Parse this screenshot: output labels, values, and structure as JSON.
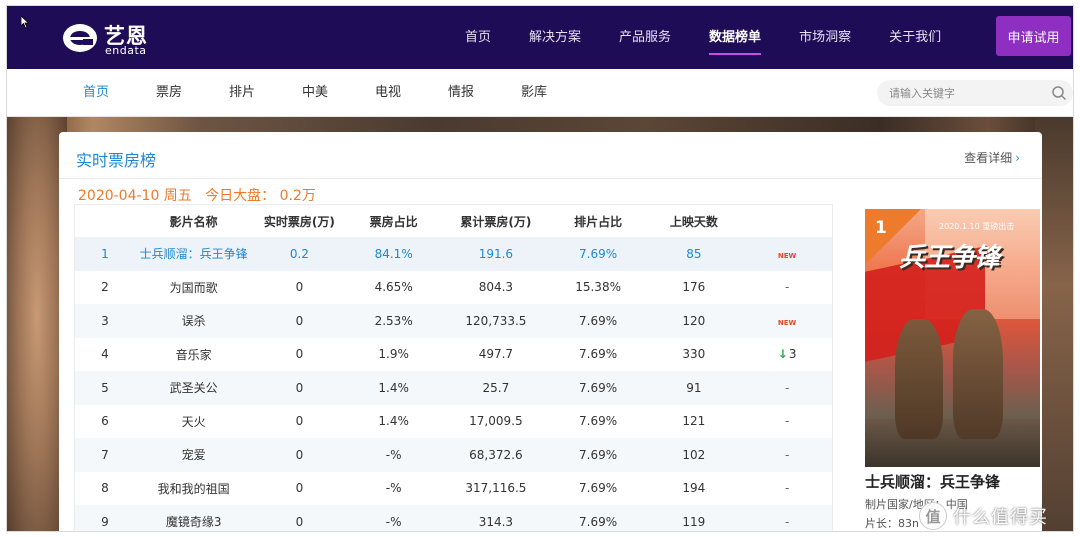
{
  "brand": {
    "name_cn": "艺恩",
    "name_en": "endata"
  },
  "top_nav": {
    "items": [
      "首页",
      "解决方案",
      "产品服务",
      "数据榜单",
      "市场洞察",
      "关于我们"
    ],
    "active": "数据榜单",
    "trial_button": "申请试用"
  },
  "sub_nav": {
    "items": [
      "首页",
      "票房",
      "排片",
      "中美",
      "电视",
      "情报",
      "影库"
    ],
    "active": "首页",
    "search_placeholder": "请输入关键字"
  },
  "section": {
    "title": "实时票房榜",
    "more_link": "查看详细",
    "date": "2020-04-10 周五",
    "market_label": "今日大盘：",
    "market_value": "0.2万"
  },
  "table": {
    "headers": [
      "",
      "影片名称",
      "实时票房(万)",
      "票房占比",
      "累计票房(万)",
      "排片占比",
      "上映天数",
      ""
    ],
    "rows": [
      {
        "rank": "1",
        "name": "士兵顺溜：兵王争锋",
        "realtime": "0.2",
        "share": "84.1%",
        "total": "191.6",
        "screen_share": "7.69%",
        "days": "85",
        "trend": "NEW"
      },
      {
        "rank": "2",
        "name": "为国而歌",
        "realtime": "0",
        "share": "4.65%",
        "total": "804.3",
        "screen_share": "15.38%",
        "days": "176",
        "trend": "-"
      },
      {
        "rank": "3",
        "name": "误杀",
        "realtime": "0",
        "share": "2.53%",
        "total": "120,733.5",
        "screen_share": "7.69%",
        "days": "120",
        "trend": "NEW"
      },
      {
        "rank": "4",
        "name": "音乐家",
        "realtime": "0",
        "share": "1.9%",
        "total": "497.7",
        "screen_share": "7.69%",
        "days": "330",
        "trend": "↓3"
      },
      {
        "rank": "5",
        "name": "武圣关公",
        "realtime": "0",
        "share": "1.4%",
        "total": "25.7",
        "screen_share": "7.69%",
        "days": "91",
        "trend": "-"
      },
      {
        "rank": "6",
        "name": "天火",
        "realtime": "0",
        "share": "1.4%",
        "total": "17,009.5",
        "screen_share": "7.69%",
        "days": "121",
        "trend": "-"
      },
      {
        "rank": "7",
        "name": "宠爱",
        "realtime": "0",
        "share": "-%",
        "total": "68,372.6",
        "screen_share": "7.69%",
        "days": "102",
        "trend": "-"
      },
      {
        "rank": "8",
        "name": "我和我的祖国",
        "realtime": "0",
        "share": "-%",
        "total": "317,116.5",
        "screen_share": "7.69%",
        "days": "194",
        "trend": "-"
      },
      {
        "rank": "9",
        "name": "魔镜奇缘3",
        "realtime": "0",
        "share": "-%",
        "total": "314.3",
        "screen_share": "7.69%",
        "days": "119",
        "trend": "-"
      }
    ]
  },
  "featured": {
    "rank": "1",
    "poster_date": "2020.1.10  重磅出击",
    "poster_title": "兵王争锋",
    "title": "士兵顺溜：兵王争锋",
    "meta_country": "制片国家/地区：中国",
    "meta_length": "片长：83n"
  },
  "watermark": {
    "icon": "值",
    "text": "什么值得买"
  },
  "colors": {
    "nav_bg": "#1f0c57",
    "accent_purple": "#8e2fc2",
    "link_blue": "#1e88d2",
    "orange": "#ee7a2c",
    "new_red": "#e8452b",
    "down_green": "#2aa84a"
  }
}
